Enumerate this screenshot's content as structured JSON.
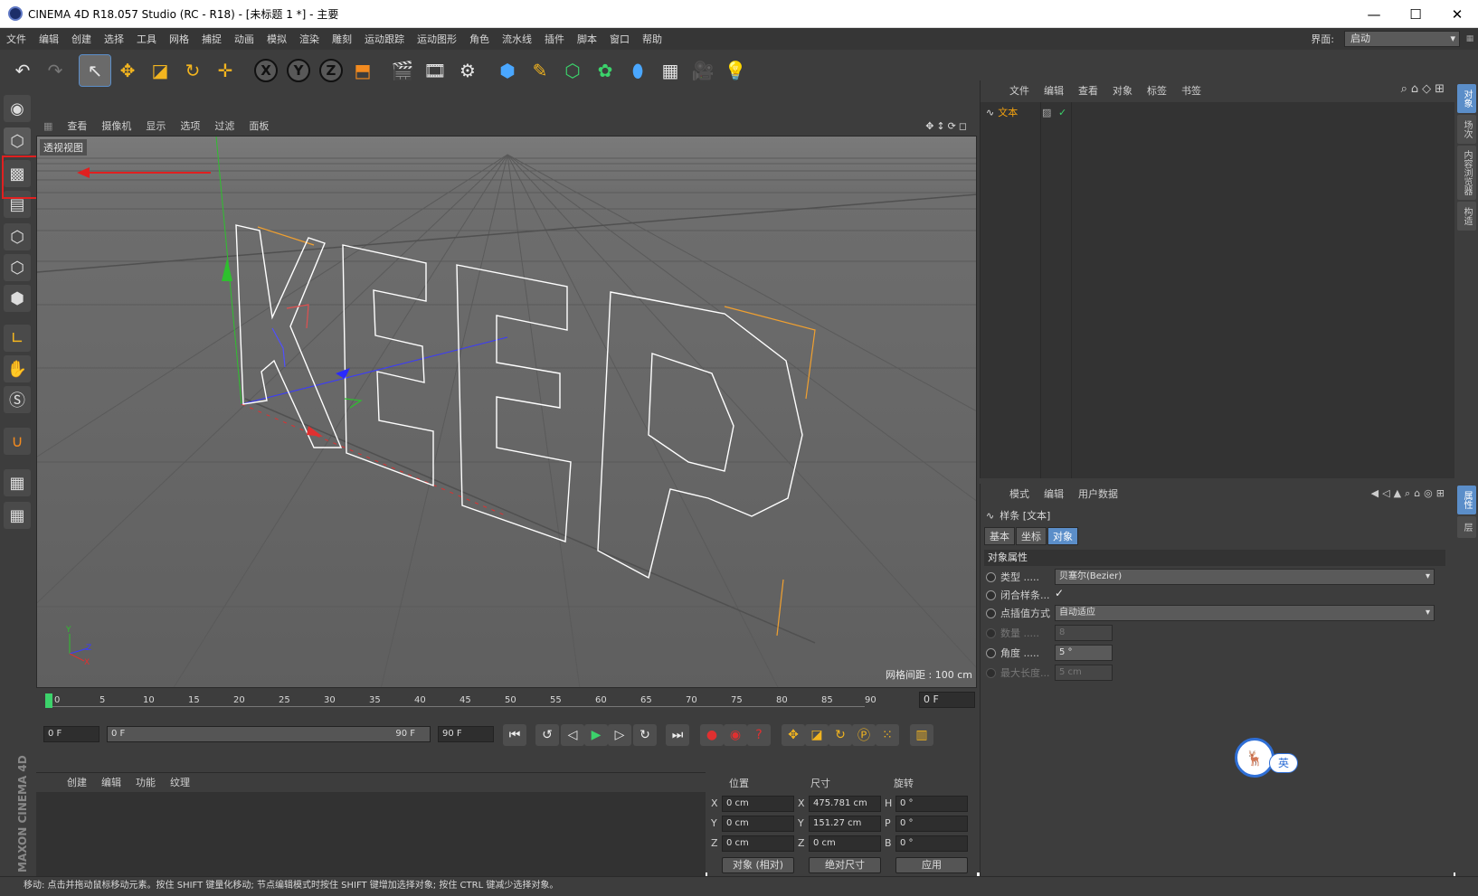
{
  "window": {
    "title": "CINEMA 4D R18.057 Studio (RC - R18) - [未标题 1 *] - 主要",
    "min": "—",
    "max": "☐",
    "close": "✕"
  },
  "menu": [
    "文件",
    "编辑",
    "创建",
    "选择",
    "工具",
    "网格",
    "捕捉",
    "动画",
    "模拟",
    "渲染",
    "雕刻",
    "运动跟踪",
    "运动图形",
    "角色",
    "流水线",
    "插件",
    "脚本",
    "窗口",
    "帮助"
  ],
  "layout": {
    "label": "界面:",
    "value": "启动"
  },
  "viewport": {
    "menu": [
      "查看",
      "摄像机",
      "显示",
      "选项",
      "过滤",
      "面板"
    ],
    "label": "透视视图",
    "grid_info": "网格间距 : 100 cm",
    "text": "KEEP"
  },
  "timeline": {
    "ticks": [
      "0",
      "5",
      "10",
      "15",
      "20",
      "25",
      "30",
      "35",
      "40",
      "45",
      "50",
      "55",
      "60",
      "65",
      "70",
      "75",
      "80",
      "85",
      "90"
    ],
    "current_frame": "0 F",
    "start": "0 F",
    "range_start": "0 F",
    "range_end": "90 F",
    "end": "90 F"
  },
  "materials": {
    "menu": [
      "创建",
      "编辑",
      "功能",
      "纹理"
    ]
  },
  "coords": {
    "headers": [
      "位置",
      "尺寸",
      "旋转"
    ],
    "rows": [
      {
        "l1": "X",
        "pos": "0 cm",
        "l2": "X",
        "size": "475.781 cm",
        "l3": "H",
        "rot": "0 °"
      },
      {
        "l1": "Y",
        "pos": "0 cm",
        "l2": "Y",
        "size": "151.27 cm",
        "l3": "P",
        "rot": "0 °"
      },
      {
        "l1": "Z",
        "pos": "0 cm",
        "l2": "Z",
        "size": "0 cm",
        "l3": "B",
        "rot": "0 °"
      }
    ],
    "mode": "对象 (相对)",
    "size_mode": "绝对尺寸",
    "apply": "应用"
  },
  "brand": "MAXON CINEMA 4D",
  "object_manager": {
    "menu": [
      "文件",
      "编辑",
      "查看",
      "对象",
      "标签",
      "书签"
    ],
    "item": "文本"
  },
  "attributes": {
    "menu": [
      "模式",
      "编辑",
      "用户数据"
    ],
    "title": "样条 [文本]",
    "tabs": [
      "基本",
      "坐标",
      "对象"
    ],
    "section": "对象属性",
    "props": [
      {
        "label": "类型 .....",
        "value": "贝塞尔(Bezier)"
      },
      {
        "label": "闭合样条...",
        "value": "✓"
      },
      {
        "label": "点插值方式",
        "value": "自动适应"
      },
      {
        "label": "数量 .....",
        "value": "8"
      },
      {
        "label": "角度 .....",
        "value": "5 °"
      },
      {
        "label": "最大长度...",
        "value": "5 cm"
      }
    ]
  },
  "right_tabs": [
    "对象",
    "场次",
    "内容浏览器",
    "构造",
    "属性",
    "层"
  ],
  "ime": {
    "label": "英"
  },
  "status": "移动: 点击并拖动鼠标移动元素。按住 SHIFT 键量化移动; 节点编辑模式时按住 SHIFT 键增加选择对象; 按住 CTRL 键减少选择对象。"
}
